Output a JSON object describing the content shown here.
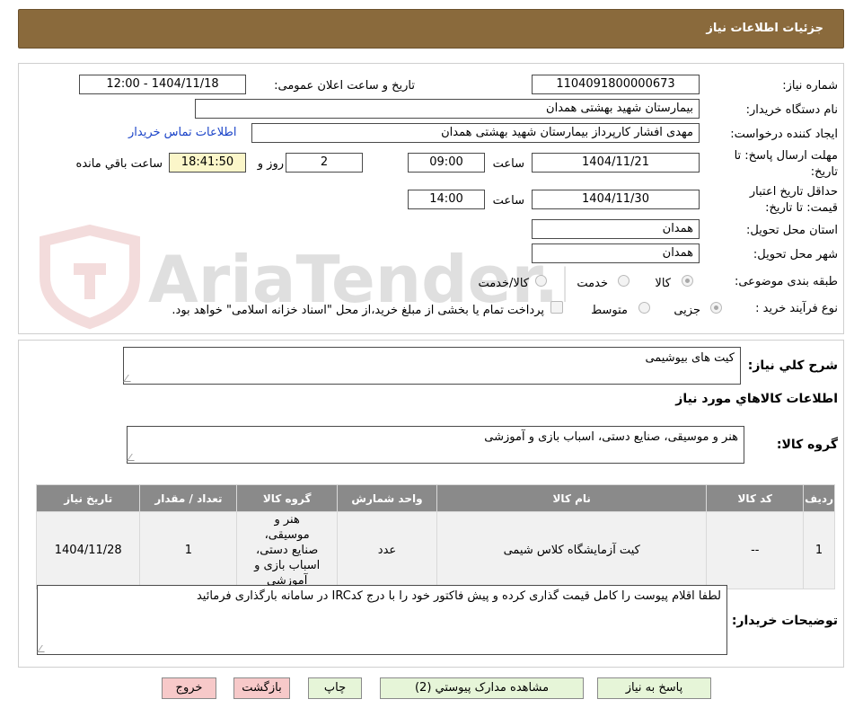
{
  "header": {
    "title": "جزئیات اطلاعات نیاز"
  },
  "form": {
    "need_number_label": "شماره نیاز:",
    "need_number": "1104091800000673",
    "announce_label": "تاریخ و ساعت اعلان عمومی:",
    "announce_value": "1404/11/18 - 12:00",
    "buyer_org_label": "نام دستگاه خریدار:",
    "buyer_org": "بیمارستان شهید بهشتی همدان",
    "creator_label": "ایجاد کننده درخواست:",
    "creator": "مهدی افشار کارپرداز بیمارستان شهید بهشتی همدان",
    "contact_link": "اطلاعات تماس خریدار",
    "deadline_label_1": "مهلت ارسال پاسخ: تا",
    "deadline_label_2": "تاریخ:",
    "deadline_date": "1404/11/21",
    "time_label": "ساعت",
    "deadline_time": "09:00",
    "days_value": "2",
    "days_label": "روز و",
    "remaining_time": "18:41:50",
    "remaining_label": "ساعت باقي مانده",
    "validity_label_1": "حداقل تاریخ اعتبار",
    "validity_label_2": "قیمت: تا تاریخ:",
    "validity_date": "1404/11/30",
    "validity_time": "14:00",
    "province_label": "استان محل تحویل:",
    "province": "همدان",
    "city_label": "شهر محل تحویل:",
    "city": "همدان",
    "category_label": "طبقه بندی موضوعی:",
    "category_options": [
      "کالا",
      "خدمت",
      "کالا/خدمت"
    ],
    "process_label": "نوع فرآیند خرید :",
    "process_options": [
      "جزیی",
      "متوسط"
    ],
    "payment_note": "پرداخت تمام یا بخشی از مبلغ خرید،از محل \"اسناد خزانه اسلامی\" خواهد بود."
  },
  "details": {
    "summary_label": "شرح کلي نیاز:",
    "summary_value": "کیت های بیوشیمی",
    "goods_info_title": "اطلاعات کالاهاي مورد نیاز",
    "goods_group_label": "گروه کالا:",
    "goods_group_value": "هنر و موسیقی، صنایع دستی، اسباب بازی و آموزشی",
    "table": {
      "headers": [
        "ردیف",
        "کد کالا",
        "نام کالا",
        "واحد شمارش",
        "گروه کالا",
        "تعداد / مقدار",
        "تاریخ نیاز"
      ],
      "rows": [
        [
          "1",
          "--",
          "کیت آزمایشگاه کلاس شیمی",
          "عدد",
          "هنر و موسیقی، صنایع دستی، اسباب بازی و آموزشی",
          "1",
          "1404/11/28"
        ]
      ]
    },
    "buyer_notes_label": "توضیحات خریدار:",
    "buyer_notes_value": "لطفا اقلام پیوست را کامل قیمت گذاری کرده و پیش فاکتور خود را با درج کدIRC در سامانه بارگذاری فرمائید"
  },
  "buttons": {
    "reply": "پاسخ به نیاز",
    "attachments": "مشاهده مدارک پیوستي (2)",
    "print": "چاپ",
    "back": "بازگشت",
    "exit": "خروج"
  },
  "watermark": {
    "text": "AriaTender.neT"
  },
  "colors": {
    "header_bg": "#8a6a3c",
    "table_header_bg": "#8a8a8a",
    "button_green": "#e6f5d8",
    "button_red": "#f7c9c9",
    "time_left_bg": "#fbf6c9",
    "link": "#1a43c8"
  }
}
